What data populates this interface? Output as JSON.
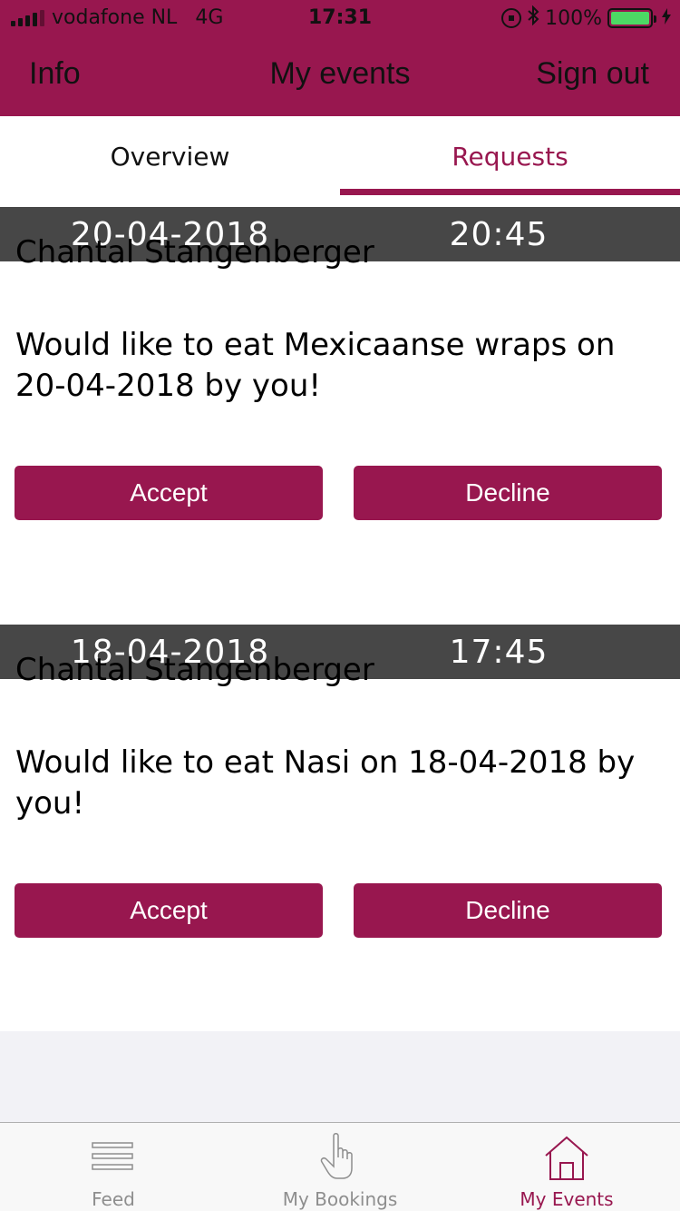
{
  "status_bar": {
    "carrier": "vodafone NL",
    "network": "4G",
    "time": "17:31",
    "battery": "100%",
    "icons": [
      "signal-icon",
      "orientation-lock-icon",
      "bluetooth-icon",
      "battery-icon",
      "charging-icon"
    ]
  },
  "nav": {
    "left": "Info",
    "title": "My events",
    "right": "Sign out"
  },
  "tabs": {
    "overview": "Overview",
    "requests": "Requests",
    "active": "requests"
  },
  "requests": [
    {
      "date": "20-04-2018",
      "time": "20:45",
      "name": "Chantal Stangenberger",
      "message": "Would like to eat Mexicaanse wraps on 20-04-2018 by you!",
      "accept": "Accept",
      "decline": "Decline"
    },
    {
      "date": "18-04-2018",
      "time": "17:45",
      "name": "Chantal Stangenberger",
      "message": "Would like to eat Nasi on 18-04-2018 by you!",
      "accept": "Accept",
      "decline": "Decline"
    }
  ],
  "tab_bar": {
    "feed": "Feed",
    "bookings": "My Bookings",
    "events": "My Events",
    "active": "events"
  },
  "colors": {
    "accent": "#98174f",
    "date_bar": "#474747",
    "inactive": "#8e8e8e",
    "battery": "#4cd964"
  }
}
